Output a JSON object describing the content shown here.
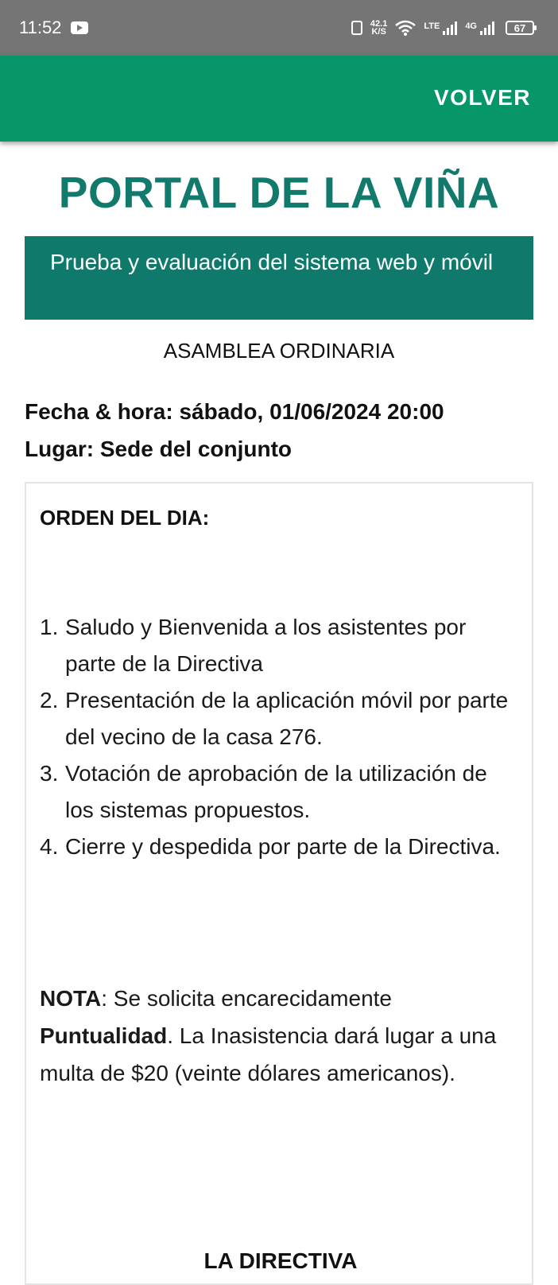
{
  "status_bar": {
    "time": "11:52",
    "net_speed_value": "42.1",
    "net_speed_unit": "K/S",
    "lte_label": "LTE",
    "fourg_label": "4G",
    "battery": "67"
  },
  "app_bar": {
    "back_label": "VOLVER",
    "color": "#079669"
  },
  "content": {
    "title": "PORTAL DE LA VIÑA",
    "subtitle": "Prueba y evaluación del sistema web y móvil",
    "meeting_type": "ASAMBLEA ORDINARIA",
    "date_line": "Fecha & hora: sábado, 01/06/2024 20:00",
    "place_line": "Lugar: Sede del conjunto",
    "agenda_title": "ORDEN DEL DIA:",
    "agenda": [
      {
        "num": "1.",
        "text": "Saludo y Bienvenida a los asistentes por parte de la Directiva"
      },
      {
        "num": "2.",
        "text": "Presentación de la aplicación móvil por parte del vecino de la casa 276."
      },
      {
        "num": "3.",
        "text": "Votación de aprobación de la utilización de los sistemas propuestos."
      },
      {
        "num": "4.",
        "text": "Cierre y despedida por parte de la Directiva."
      }
    ],
    "note_label": "NOTA",
    "note_text_1": ": Se solicita encarecidamente ",
    "note_emphasis": "Puntualidad",
    "note_text_2": ". La Inasistencia dará lugar a una multa de $20 (veinte dólares americanos).",
    "signature": "LA DIRECTIVA",
    "accent_color": "#127a6c"
  }
}
